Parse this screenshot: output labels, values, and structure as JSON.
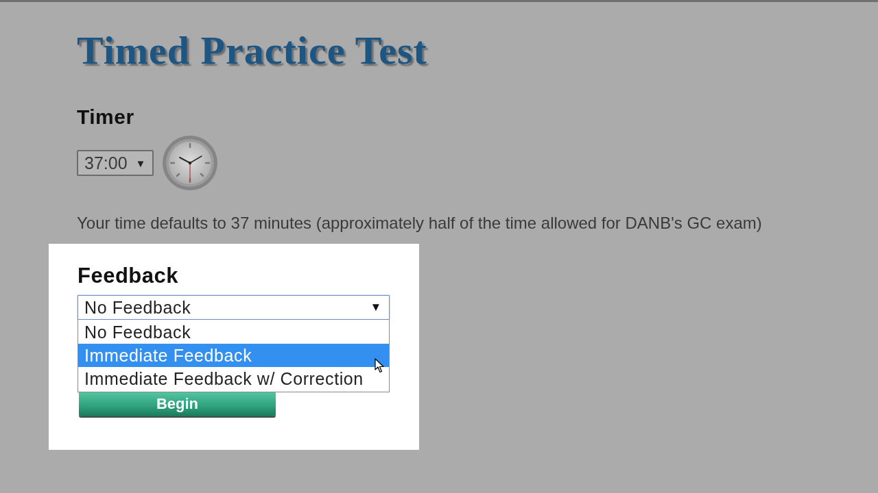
{
  "title": "Timed Practice Test",
  "timer": {
    "label": "Timer",
    "select": {
      "value": "37:00",
      "caret": "▼"
    }
  },
  "note": "Your time defaults to 37 minutes (approximately half of the time allowed for DANB's GC exam)",
  "feedback": {
    "label": "Feedback",
    "select": {
      "value": "No Feedback",
      "caret": "▼",
      "expanded": true
    },
    "options": [
      {
        "label": "No Feedback",
        "selected": false
      },
      {
        "label": "Immediate Feedback",
        "selected": true
      },
      {
        "label": "Immediate Feedback w/ Correction",
        "selected": false
      }
    ]
  },
  "begin_button": {
    "label": "Begin"
  }
}
